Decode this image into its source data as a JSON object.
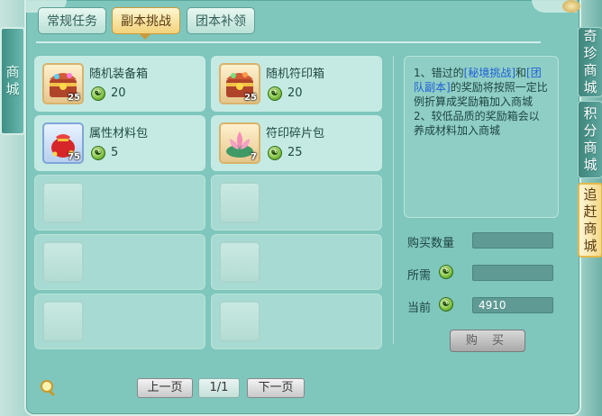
{
  "left_tab": {
    "chars": [
      "商",
      "城"
    ]
  },
  "right_tabs": [
    {
      "chars": [
        "奇",
        "珍",
        "商",
        "城"
      ]
    },
    {
      "chars": [
        "积",
        "分",
        "商",
        "城"
      ]
    },
    {
      "chars": [
        "追",
        "赶",
        "商",
        "城"
      ]
    }
  ],
  "top_tabs": [
    {
      "label": "常规任务",
      "active": false
    },
    {
      "label": "副本挑战",
      "active": true
    },
    {
      "label": "团本补领",
      "active": false
    }
  ],
  "items": [
    {
      "name": "随机装备箱",
      "price": "20",
      "qty": "25",
      "icon": "treasure-chest-icon"
    },
    {
      "name": "随机符印箱",
      "price": "20",
      "qty": "25",
      "icon": "treasure-chest-icon"
    },
    {
      "name": "属性材料包",
      "price": "5",
      "qty": "75",
      "icon": "material-bag-icon"
    },
    {
      "name": "符印碎片包",
      "price": "25",
      "qty": "7",
      "icon": "lotus-bag-icon"
    }
  ],
  "info": {
    "line1_prefix": "1、错过的",
    "link1": "[秘境挑战]",
    "line1_mid": "和",
    "link2": "[团队副本]",
    "line1_suffix": "的奖励将按照一定比例折算成奖励箱加入商城",
    "line2": "2、较低品质的奖励箱会以养成材料加入商城"
  },
  "purchase": {
    "qty_label": "购买数量",
    "cost_label": "所需",
    "current_label": "当前",
    "qty_value": "",
    "cost_value": "",
    "current_value": "4910",
    "buy_label": "购 买"
  },
  "pagination": {
    "prev": "上一页",
    "page": "1/1",
    "next": "下一页"
  },
  "coin_glyph": "☯"
}
